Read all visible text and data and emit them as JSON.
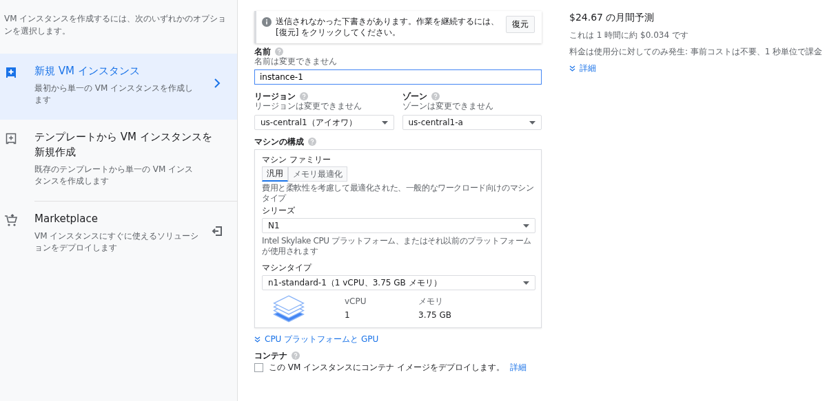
{
  "sidebar": {
    "intro": "VM インスタンスを作成するには、次のいずれかのオプションを選択します。",
    "items": [
      {
        "kind": "new",
        "title": "新規 VM インスタンス",
        "description": "最初から単一の VM インスタンスを作成します",
        "selected": true
      },
      {
        "kind": "template",
        "title": "テンプレートから VM インスタンスを新規作成",
        "description": "既存のテンプレートから単一の VM インスタンスを作成します",
        "selected": false
      },
      {
        "kind": "marketplace",
        "title": "Marketplace",
        "description": "VM インスタンスにすぐに使えるソリューションをデプロイします",
        "selected": false
      }
    ]
  },
  "draft_notice": {
    "text": "送信されなかった下書きがあります。作業を継続するには、[復元] をクリックしてください。",
    "button": "復元"
  },
  "name": {
    "label": "名前",
    "hint": "名前は変更できません",
    "value": "instance-1"
  },
  "region": {
    "label": "リージョン",
    "hint": "リージョンは変更できません",
    "value": "us-central1（アイオワ）"
  },
  "zone": {
    "label": "ゾーン",
    "hint": "ゾーンは変更できません",
    "value": "us-central1-a"
  },
  "machine_config": {
    "label": "マシンの構成",
    "family_label": "マシン ファミリー",
    "tabs": [
      {
        "label": "汎用",
        "selected": true
      },
      {
        "label": "メモリ最適化",
        "selected": false
      }
    ],
    "family_description": "費用と柔軟性を考慮して最適化された、一般的なワークロード向けのマシンタイプ",
    "series_label": "シリーズ",
    "series_value": "N1",
    "series_description": "Intel Skylake CPU プラットフォーム、またはそれ以前のプラットフォームが使用されます",
    "type_label": "マシンタイプ",
    "type_value": "n1-standard-1（1 vCPU、3.75 GB メモリ）",
    "specs": [
      {
        "label": "vCPU",
        "value": "1"
      },
      {
        "label": "メモリ",
        "value": "3.75 GB"
      }
    ]
  },
  "cpu_gpu_link": "CPU プラットフォームと GPU",
  "container": {
    "label": "コンテナ",
    "checkbox_label": "この VM インスタンスにコンテナ イメージをデプロイします。",
    "checked": false,
    "link": "詳細"
  },
  "estimate": {
    "title": "$24.67 の月間予測",
    "hourly": "これは 1 時間に約 $0.034 です",
    "billing": "料金は使用分に対してのみ発生: 事前コストは不要、1 秒単位で課金",
    "details_link": "詳細"
  }
}
